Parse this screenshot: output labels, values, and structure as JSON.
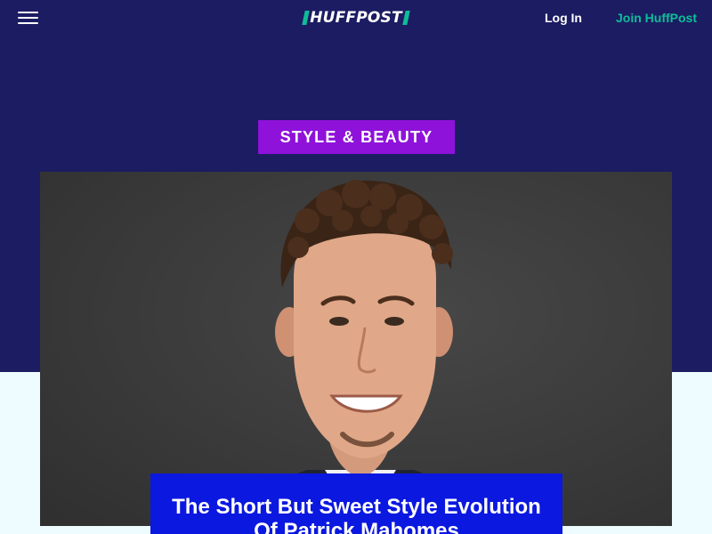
{
  "header": {
    "logo_text": "HUFFPOST",
    "login_label": "Log In",
    "join_label": "Join HuffPost"
  },
  "section": {
    "label": "STYLE & BEAUTY"
  },
  "article": {
    "headline": "The Short But Sweet Style Evolution Of Patrick Mahomes"
  },
  "colors": {
    "header_background": "#1c1c63",
    "page_background": "#eefcff",
    "logo_accent": "#0dbe98",
    "join_link": "#0dbe98",
    "section_tag": "#8e12d9",
    "headline_box": "#0b18e0"
  },
  "icons": {
    "menu": "hamburger-menu-icon"
  }
}
